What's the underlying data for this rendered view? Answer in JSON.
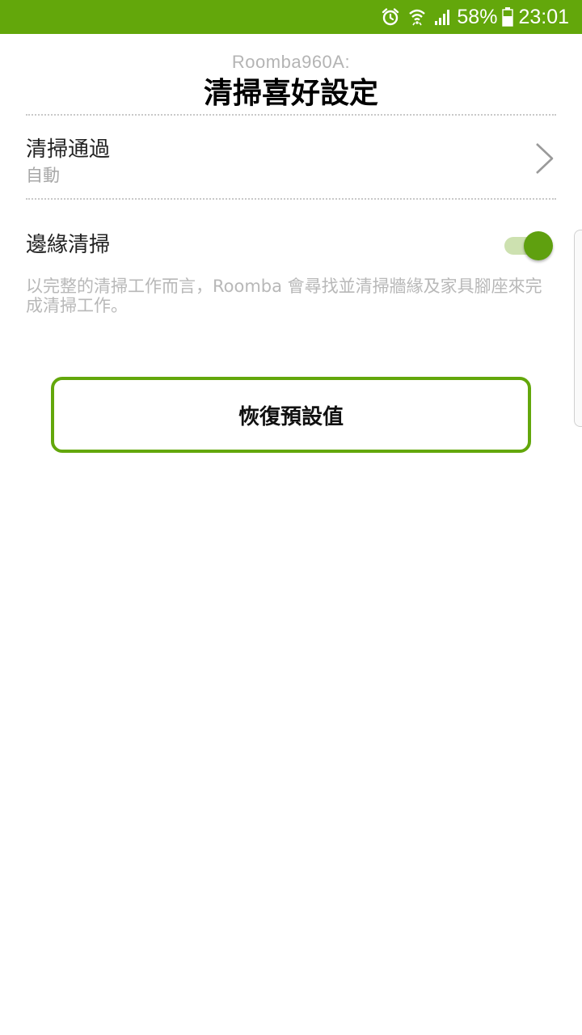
{
  "status_bar": {
    "battery_percent": "58%",
    "time": "23:01",
    "icons": [
      "alarm-icon",
      "wifi-icon",
      "signal-icon",
      "battery-icon"
    ],
    "background_color": "#63a70b"
  },
  "header": {
    "robot_name": "Roomba960A:",
    "title": "清掃喜好設定"
  },
  "settings": {
    "cleaning_passes": {
      "label": "清掃通過",
      "value": "自動"
    },
    "edge_clean": {
      "label": "邊緣清掃",
      "enabled": true,
      "description": "以完整的清掃工作而言，Roomba 會尋找並清掃牆緣及家具腳座來完成清掃工作。"
    }
  },
  "reset_button": {
    "label": "恢復預設值"
  },
  "colors": {
    "accent": "#63a70b",
    "toggle_track": "#cde1b0",
    "muted_text": "#b8b8b8"
  }
}
